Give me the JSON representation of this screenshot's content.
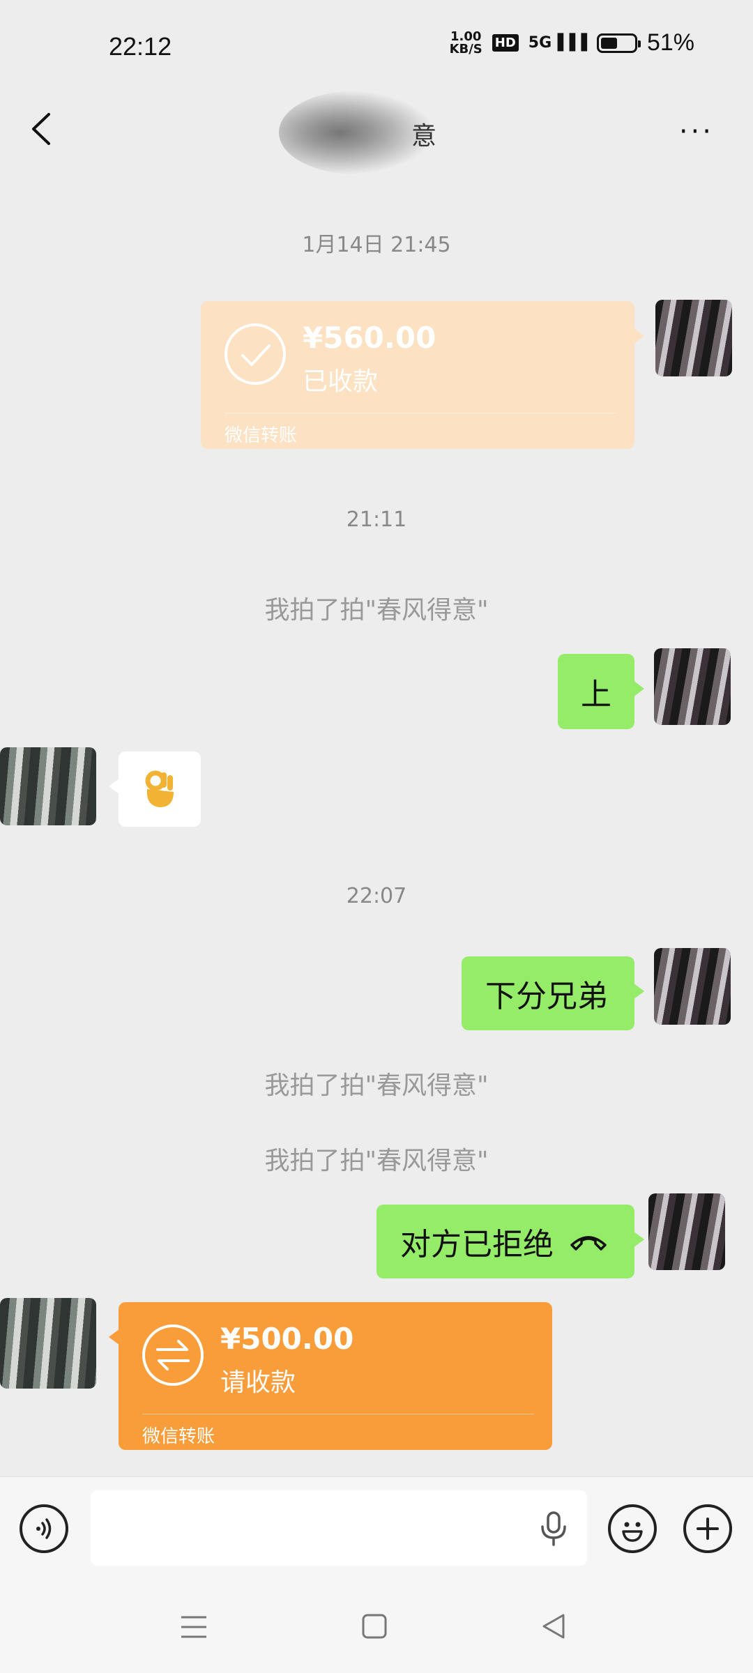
{
  "status_bar": {
    "time": "22:12",
    "net_speed_top": "1.00",
    "net_speed_bottom": "KB/S",
    "hd_label": "HD",
    "signal_label": "5G",
    "battery_level": 0.51,
    "battery_text": "51%"
  },
  "header": {
    "title_visible_char": "意",
    "more_label": "···"
  },
  "messages": {
    "ts1": "1月14日 21:45",
    "transfer1": {
      "amount": "¥560.00",
      "status": "已收款",
      "footer": "微信转账"
    },
    "ts2": "21:11",
    "sys1": "我拍了拍\"春风得意\"",
    "bubble1": "上",
    "ts3": "22:07",
    "bubble2": "下分兄弟",
    "sys2": "我拍了拍\"春风得意\"",
    "sys3": "我拍了拍\"春风得意\"",
    "bubble3": "对方已拒绝",
    "transfer2": {
      "amount": "¥500.00",
      "status": "请收款",
      "footer": "微信转账"
    }
  },
  "input": {
    "placeholder": ""
  },
  "colors": {
    "background": "#ededed",
    "green_bubble": "#95ec69",
    "transfer_received": "#fde1c3",
    "transfer_request": "#f99d3a"
  },
  "icons": [
    "back-arrow-icon",
    "more-dots-icon",
    "check-icon",
    "transfer-arrows-icon",
    "ok-hand-icon",
    "hangup-phone-icon",
    "voice-icon",
    "microphone-icon",
    "emoji-icon",
    "plus-icon",
    "menu-icon",
    "home-square-icon",
    "back-triangle-icon"
  ]
}
